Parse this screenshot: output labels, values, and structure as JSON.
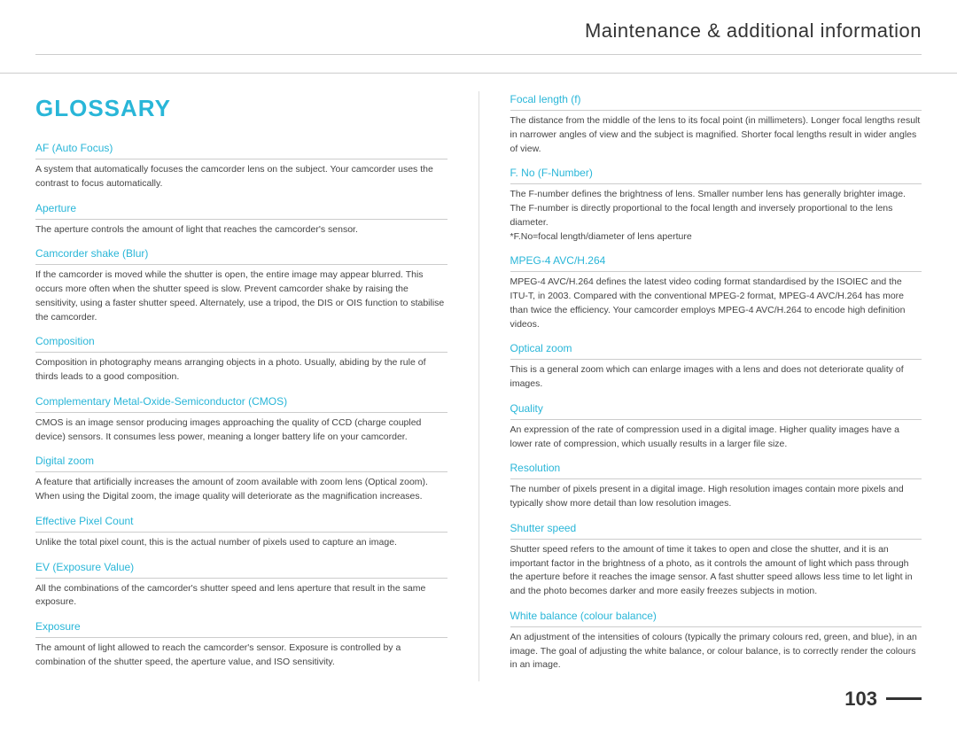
{
  "header": {
    "title": "Maintenance & additional information"
  },
  "glossary": {
    "title": "GLOSSARY"
  },
  "left_terms": [
    {
      "heading": "AF (Auto Focus)",
      "body": "A system that automatically focuses the camcorder lens on the subject. Your camcorder uses the contrast to focus automatically."
    },
    {
      "heading": "Aperture",
      "body": "The aperture controls the amount of light that reaches the camcorder's sensor."
    },
    {
      "heading": "Camcorder shake (Blur)",
      "body": "If the camcorder is moved while the shutter is open, the entire image may appear blurred. This occurs more often when the shutter speed is slow. Prevent camcorder shake by raising the sensitivity, using a faster shutter speed. Alternately, use a tripod, the DIS or OIS function to stabilise the camcorder."
    },
    {
      "heading": "Composition",
      "body": "Composition in photography means arranging objects in a photo. Usually, abiding by the rule of thirds leads to a good composition."
    },
    {
      "heading": "Complementary Metal-Oxide-Semiconductor (CMOS)",
      "body": "CMOS is an image sensor producing images approaching the quality of CCD (charge coupled device) sensors. It consumes less power, meaning a longer battery life on your camcorder."
    },
    {
      "heading": "Digital zoom",
      "body": "A feature that artificially increases the amount of zoom available with zoom lens (Optical zoom). When using the Digital zoom, the image quality will deteriorate as the magnification increases."
    },
    {
      "heading": "Effective Pixel Count",
      "body": "Unlike the total pixel count, this is the actual number of pixels used to capture an image."
    },
    {
      "heading": "EV (Exposure Value)",
      "body": "All the combinations of the camcorder's shutter speed and lens aperture that result in the same exposure."
    },
    {
      "heading": "Exposure",
      "body": "The amount of light allowed to reach the camcorder's sensor. Exposure is controlled by a combination of the shutter speed, the aperture value, and ISO sensitivity."
    }
  ],
  "right_terms": [
    {
      "heading": "Focal length (f)",
      "body": "The distance from the middle of the lens to its focal point (in millimeters). Longer focal lengths result in narrower angles of view and the subject is magnified. Shorter focal lengths result in wider angles of view."
    },
    {
      "heading": "F. No (F-Number)",
      "body": "The F-number defines the brightness of lens. Smaller number lens has generally brighter image. The F-number is directly proportional to the focal length and inversely proportional to the lens diameter.\n*F.No=focal length/diameter of lens aperture"
    },
    {
      "heading": "MPEG-4 AVC/H.264",
      "body": "MPEG-4 AVC/H.264 defines the latest video coding format standardised by the ISOIEC and the ITU-T, in 2003. Compared with the conventional MPEG-2 format, MPEG-4 AVC/H.264 has more than twice the efficiency. Your camcorder employs MPEG-4 AVC/H.264 to encode high definition videos."
    },
    {
      "heading": "Optical zoom",
      "body": "This is a general zoom which can enlarge images with a lens and does not deteriorate quality of images."
    },
    {
      "heading": "Quality",
      "body": "An expression of the rate of compression used in a digital image. Higher quality images have a lower rate of compression, which usually results in a larger file size."
    },
    {
      "heading": "Resolution",
      "body": "The number of pixels present in a digital image. High resolution images contain more pixels and typically show more detail than low resolution images."
    },
    {
      "heading": "Shutter speed",
      "body": "Shutter speed refers to the amount of time it takes to open and close the shutter, and it is an important factor in the brightness of a photo, as it controls the amount of light which pass through the aperture before it reaches the image sensor. A fast shutter speed allows less time to let light in and the photo becomes darker and more easily freezes subjects in motion."
    },
    {
      "heading": "White balance (colour balance)",
      "body": "An adjustment of the intensities of colours (typically the primary colours red, green, and blue), in an image. The goal of adjusting the white balance, or colour balance, is to correctly render the colours in an image."
    }
  ],
  "page_number": "103"
}
